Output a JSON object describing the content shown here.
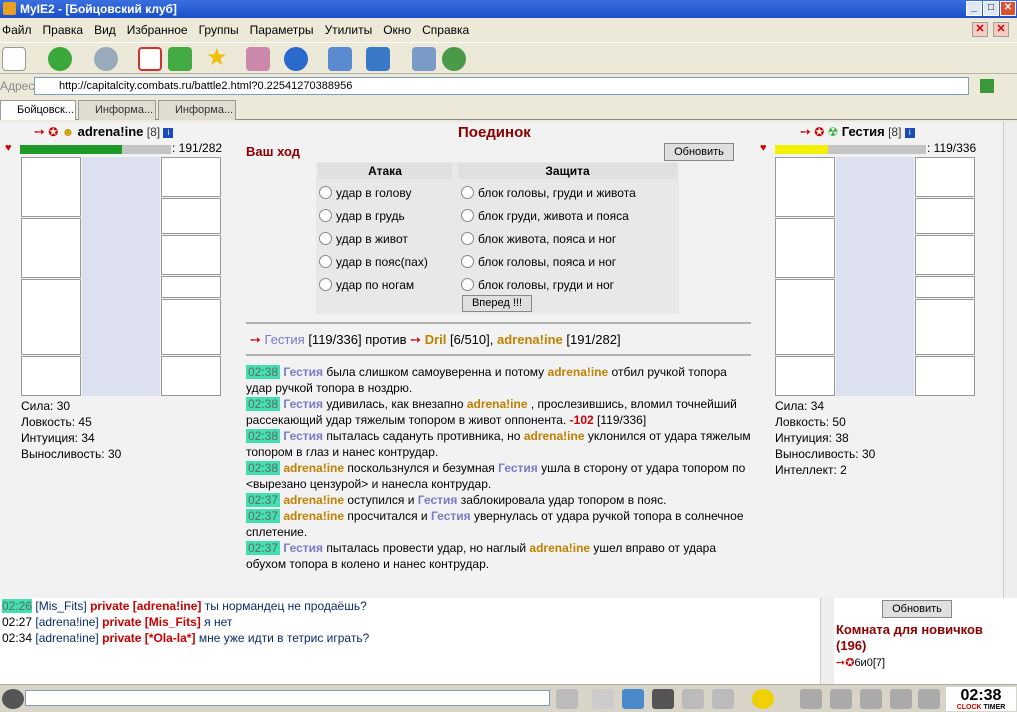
{
  "window": {
    "title": "MyIE2 - [Бойцовский клуб]"
  },
  "menu": [
    "Файл",
    "Правка",
    "Вид",
    "Избранное",
    "Группы",
    "Параметры",
    "Утилиты",
    "Окно",
    "Справка"
  ],
  "address": {
    "label": "Адрес",
    "url": "http://capitalcity.combats.ru/battle2.html?0.22541270388956"
  },
  "tabs": [
    "Бойцовск...",
    "Информа...",
    "Информа..."
  ],
  "battle": {
    "title": "Поединок",
    "your_turn": "Ваш ход",
    "refresh_label": "Обновить",
    "attack_header": "Атака",
    "defense_header": "Защита",
    "attacks": [
      "удар в голову",
      "удар в грудь",
      "удар в живот",
      "удар в пояс(пах)",
      "удар по ногам"
    ],
    "defenses": [
      "блок головы, груди и живота",
      "блок груди, живота и пояса",
      "блок живота, пояса и ног",
      "блок головы, пояса и ног",
      "блок головы, груди и ног"
    ],
    "forward_label": "Вперед !!!",
    "versus": {
      "p1": "Гестия",
      "p1_hp": "[119/336]",
      "word": "против",
      "p2": "Dril",
      "p2_hp": "[6/510],",
      "p3": "adrena!ine",
      "p3_hp": "[191/282]"
    }
  },
  "player_left": {
    "name": "adrena!ine",
    "level": "[8]",
    "hp_text": ": 191/282",
    "hp_fraction": 0.677,
    "stats": [
      "Сила: 30",
      "Ловкость: 45",
      "Интуиция: 34",
      "Выносливость: 30"
    ]
  },
  "player_right": {
    "name": "Гестия",
    "level": "[8]",
    "hp_text": ": 119/336",
    "hp_fraction": 0.354,
    "stats": [
      "Сила: 34",
      "Ловкость: 50",
      "Интуиция: 38",
      "Выносливость: 30",
      "Интеллект: 2"
    ]
  },
  "log": [
    {
      "time": "02:38",
      "parts": [
        {
          "c": "p1",
          "t": "Гестия"
        },
        {
          "c": "",
          "t": " была слишком самоуверенна и потому "
        },
        {
          "c": "p2",
          "t": "adrena!ine"
        },
        {
          "c": "",
          "t": " отбил ручкой топора удар ручкой топора в ноздрю."
        }
      ]
    },
    {
      "time": "02:38",
      "parts": [
        {
          "c": "p1",
          "t": "Гестия"
        },
        {
          "c": "",
          "t": " удивилась, как внезапно "
        },
        {
          "c": "p2",
          "t": "adrena!ine"
        },
        {
          "c": "",
          "t": " , прослезившись, вломил точнейший рассекающий удар тяжелым топором в живот оппонента. "
        },
        {
          "c": "dmg",
          "t": "-102"
        },
        {
          "c": "",
          "t": " [119/336]"
        }
      ]
    },
    {
      "time": "02:38",
      "parts": [
        {
          "c": "p1",
          "t": "Гестия"
        },
        {
          "c": "",
          "t": " пыталась садануть противника, но "
        },
        {
          "c": "p2",
          "t": "adrena!ine"
        },
        {
          "c": "",
          "t": " уклонился от удара тяжелым топором в глаз и нанес контрудар."
        }
      ]
    },
    {
      "time": "02:38",
      "parts": [
        {
          "c": "p2",
          "t": "adrena!ine"
        },
        {
          "c": "",
          "t": " поскользнулся и безумная "
        },
        {
          "c": "p1",
          "t": "Гестия"
        },
        {
          "c": "",
          "t": " ушла в сторону от удара топором по <вырезано цензурой> и нанесла контрудар."
        }
      ]
    },
    {
      "time": "02:37",
      "parts": [
        {
          "c": "p2",
          "t": "adrena!ine"
        },
        {
          "c": "",
          "t": " оступился и "
        },
        {
          "c": "p1",
          "t": "Гестия"
        },
        {
          "c": "",
          "t": " заблокировала удар топором в пояс."
        }
      ]
    },
    {
      "time": "02:37",
      "parts": [
        {
          "c": "p2",
          "t": "adrena!ine"
        },
        {
          "c": "",
          "t": " просчитался и "
        },
        {
          "c": "p1",
          "t": "Гестия"
        },
        {
          "c": "",
          "t": " увернулась от удара ручкой топора в солнечное сплетение."
        }
      ]
    },
    {
      "time": "02:37",
      "parts": [
        {
          "c": "p1",
          "t": "Гестия"
        },
        {
          "c": "",
          "t": " пыталась провести удар, но наглый "
        },
        {
          "c": "p2",
          "t": "adrena!ine"
        },
        {
          "c": "",
          "t": " ушел вправо от удара обухом топора в колено и нанес контрудар."
        }
      ]
    }
  ],
  "chat": [
    {
      "time": "02:26",
      "who": "[Mis_Fits]",
      "pv": "private [adrena!ine]",
      "msg": "ты нормандец не продаёшь?"
    },
    {
      "time": "02:27",
      "who": "[adrena!ine]",
      "pv": "private [Mis_Fits]",
      "msg": "я нет"
    },
    {
      "time": "02:34",
      "who": "[adrena!ine]",
      "pv": "private [*Ola-la*]",
      "msg": "мне уже идти в тетрис играть?"
    }
  ],
  "room": {
    "refresh_label": "Обновить",
    "title": "Комната для новичков (196)",
    "user": "6и0[7]"
  },
  "clock": {
    "time": "02:38",
    "clock_label": "CLOCK",
    "timer_label": "TIMER"
  },
  "colors": {
    "hp_left": "#1e9a28",
    "hp_right": "#f0f000",
    "accent": "#8b0000"
  }
}
